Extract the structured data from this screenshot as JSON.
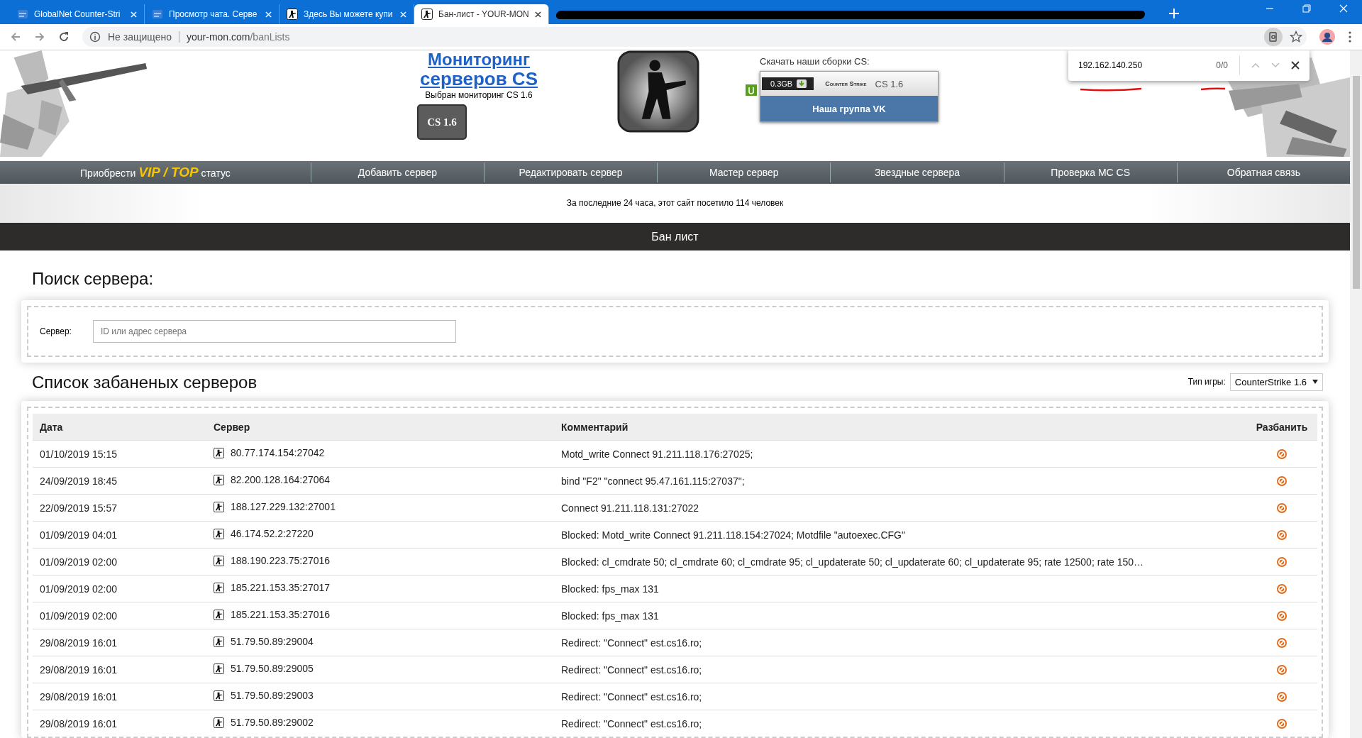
{
  "browser": {
    "tabs": [
      {
        "title": "GlobalNet Counter-Stri",
        "kind": "site",
        "selected": false
      },
      {
        "title": "Просмотр чата. Серве",
        "kind": "site",
        "selected": false
      },
      {
        "title": "Здесь Вы можете купи",
        "kind": "cs",
        "selected": false
      },
      {
        "title": "Бан-лист - YOUR-MON",
        "kind": "cs",
        "selected": true
      },
      {
        "kind": "redacted",
        "selected": false
      }
    ],
    "security": "Не защищено",
    "url_host": "your-mon.com",
    "url_path": "/banLists",
    "find_bar": {
      "value": "192.162.140.250",
      "count": "0/0"
    }
  },
  "header": {
    "title_top": "Мониторинг",
    "title": "серверов CS",
    "subtitle": "Выбран мониторинг CS 1.6",
    "game_button": "CS 1.6",
    "download_label": "Скачать наши сборки CS:",
    "download": {
      "size": "0.3GB",
      "brand": "Counter Strike",
      "version": "CS 1.6"
    },
    "vk_button": "Наша группа VK"
  },
  "nav": [
    "Приобрести **VIP / TOP** статус",
    "Добавить сервер",
    "Редактировать сервер",
    "Мастер сервер",
    "Звездные сервера",
    "Проверка МС CS",
    "Обратная связь"
  ],
  "visitors": "За последние 24 часа, этот сайт посетило 114 человек",
  "page_title": "Бан лист",
  "search": {
    "heading": "Поиск сервера:",
    "label": "Сервер:",
    "placeholder": "ID или адрес сервера"
  },
  "list": {
    "heading": "Список забаненых серверов",
    "game_label": "Тип игры:",
    "game": "CounterStrike 1.6",
    "columns": [
      "Дата",
      "Сервер",
      "Комментарий",
      "Разбанить"
    ],
    "rows": [
      {
        "date": "01/10/2019 15:15",
        "server": "80.77.174.154:27042",
        "comment": "Motd_write Connect 91.211.118.176:27025;"
      },
      {
        "date": "24/09/2019 18:45",
        "server": "82.200.128.164:27064",
        "comment": "bind \"F2\" \"connect 95.47.161.115:27037\";"
      },
      {
        "date": "22/09/2019 15:57",
        "server": "188.127.229.132:27001",
        "comment": "Connect 91.211.118.131:27022"
      },
      {
        "date": "01/09/2019 04:01",
        "server": "46.174.52.2:27220",
        "comment": "Blocked: Motd_write Connect 91.211.118.154:27024; Motdfile \"autoexec.CFG\""
      },
      {
        "date": "01/09/2019 02:00",
        "server": "188.190.223.75:27016",
        "comment": "Blocked: cl_cmdrate 50; cl_cmdrate 60; cl_cmdrate 95; cl_updaterate 50; cl_updaterate 60; cl_updaterate 95; rate 12500; rate 150…"
      },
      {
        "date": "01/09/2019 02:00",
        "server": "185.221.153.35:27017",
        "comment": "Blocked: fps_max 131"
      },
      {
        "date": "01/09/2019 02:00",
        "server": "185.221.153.35:27016",
        "comment": "Blocked: fps_max 131"
      },
      {
        "date": "29/08/2019 16:01",
        "server": "51.79.50.89:29004",
        "comment": "Redirect: \"Connect\" est.cs16.ro;"
      },
      {
        "date": "29/08/2019 16:01",
        "server": "51.79.50.89:29005",
        "comment": "Redirect: \"Connect\" est.cs16.ro;"
      },
      {
        "date": "29/08/2019 16:01",
        "server": "51.79.50.89:29003",
        "comment": "Redirect: \"Connect\" est.cs16.ro;"
      },
      {
        "date": "29/08/2019 16:01",
        "server": "51.79.50.89:29002",
        "comment": "Redirect: \"Connect\" est.cs16.ro;"
      }
    ]
  }
}
